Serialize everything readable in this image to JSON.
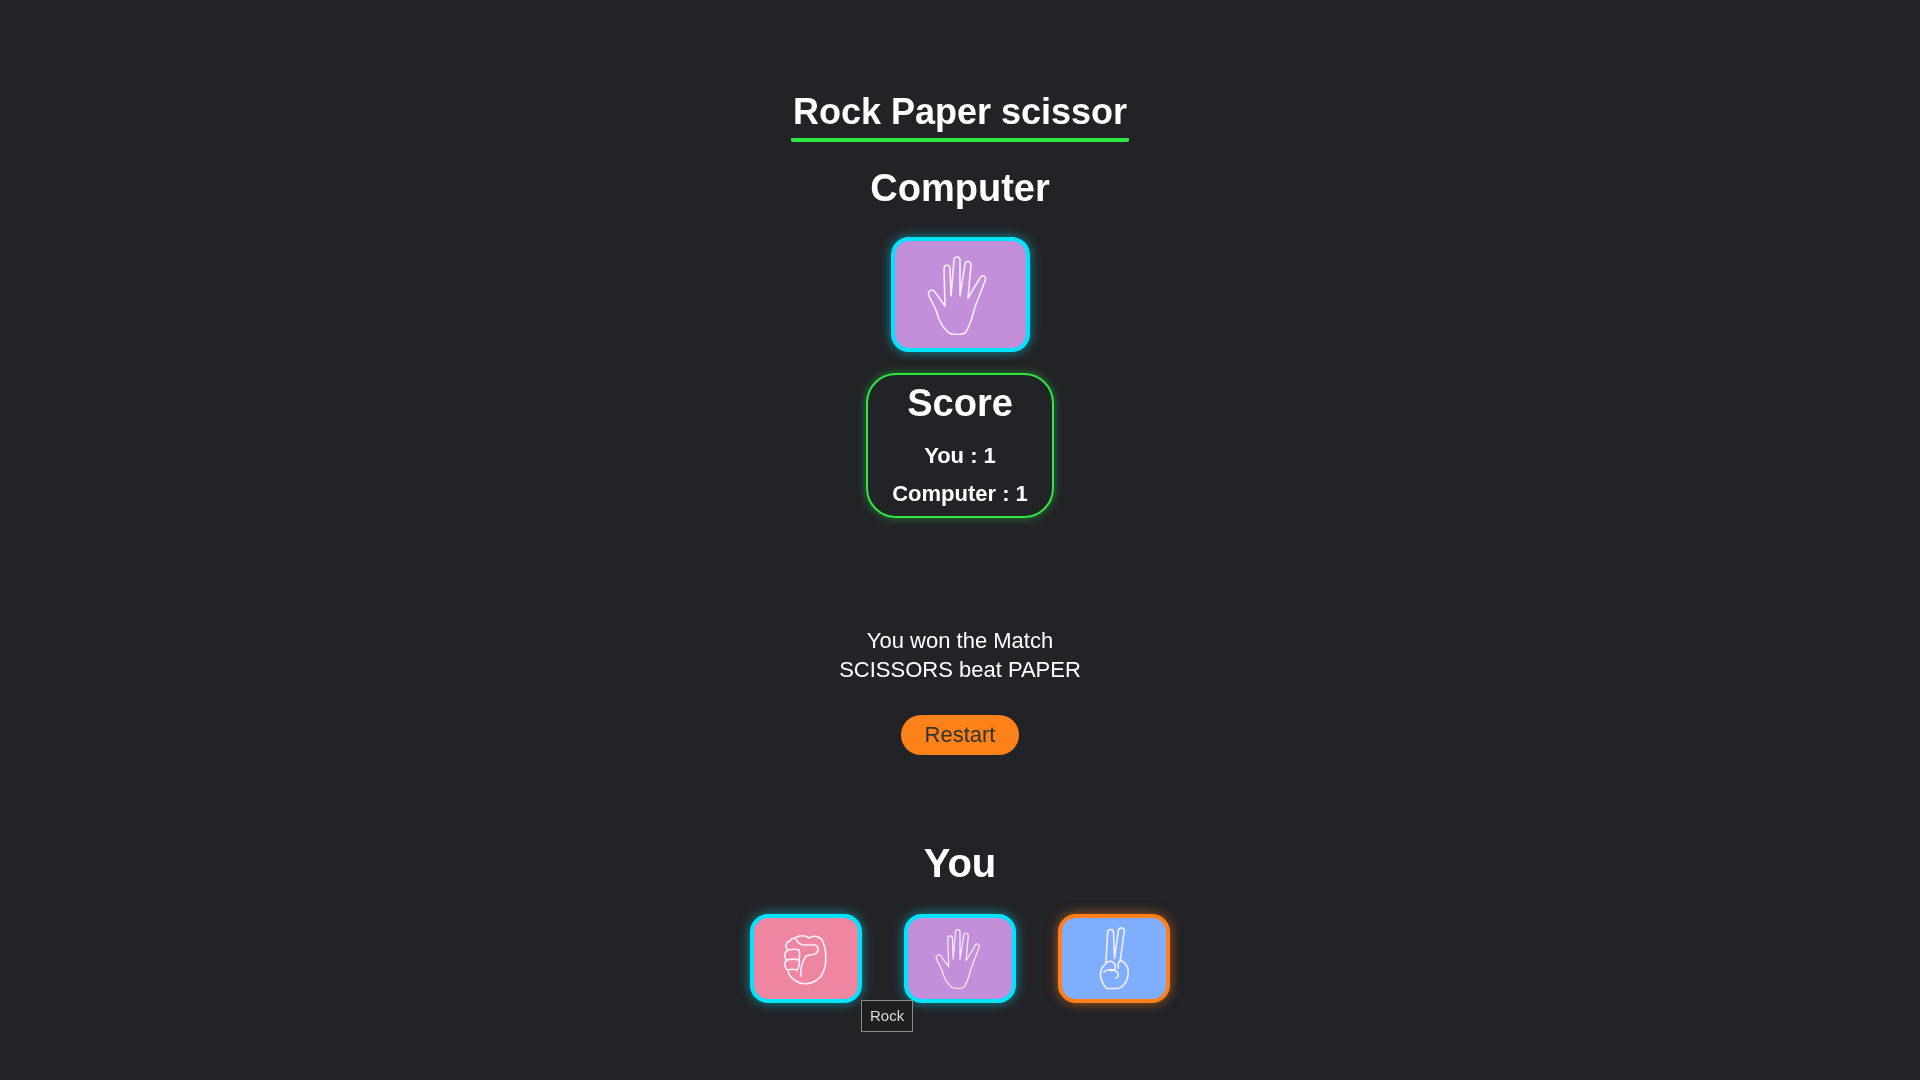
{
  "title": "Rock Paper scissor",
  "computer": {
    "heading": "Computer",
    "choice": {
      "kind": "paper"
    }
  },
  "score": {
    "heading": "Score",
    "lines": [
      "You : 1",
      "Computer : 1"
    ]
  },
  "message": [
    "You won the Match",
    "SCISSORS beat PAPER"
  ],
  "restart_button": {
    "label": "Restart"
  },
  "player": {
    "heading": "You",
    "choices": [
      {
        "kind": "rock",
        "selected": false,
        "tooltip": "Rock"
      },
      {
        "kind": "paper",
        "selected": false
      },
      {
        "kind": "scissors",
        "selected": true
      }
    ]
  }
}
